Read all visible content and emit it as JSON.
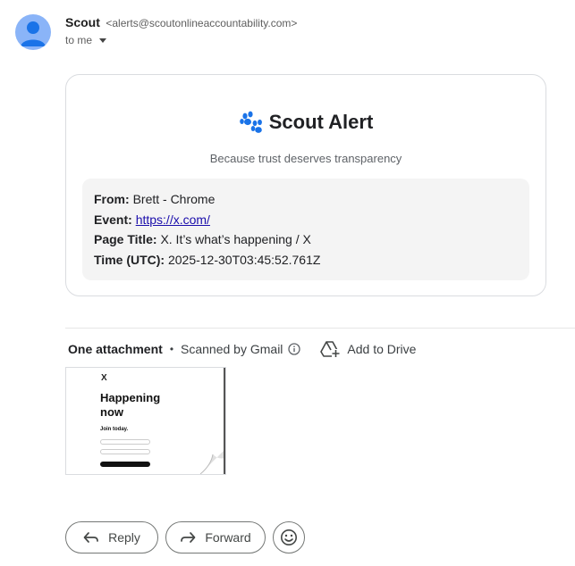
{
  "header": {
    "sender_name": "Scout",
    "sender_email": "<alerts@scoutonlineaccountability.com>",
    "to_label": "to me"
  },
  "card": {
    "title": "Scout Alert",
    "subtitle": "Because trust deserves transparency",
    "fields": [
      {
        "label": "From:",
        "value": "Brett - Chrome"
      },
      {
        "label": "Event:",
        "value": "https://x.com/"
      },
      {
        "label": "Page Title:",
        "value": "X. It’s what’s happening / X"
      },
      {
        "label": "Time (UTC):",
        "value": "2025-12-30T03:45:52.761Z"
      }
    ]
  },
  "attachments": {
    "title": "One attachment",
    "scan_status": "Scanned by Gmail",
    "drive_label": "Add to Drive"
  },
  "thumbnail": {
    "logo": "X",
    "headline": "Happening now",
    "join": "Join today."
  },
  "actions": {
    "reply_label": "Reply",
    "forward_label": "Forward"
  },
  "icons": {
    "avatar": "person-icon",
    "paw": "paw-icon",
    "info": "info-icon",
    "drive": "add-to-drive-icon",
    "reply": "reply-icon",
    "forward": "forward-icon",
    "emoji": "emoji-icon"
  },
  "colors": {
    "avatar_bg": "#8ab4f8",
    "avatar_fg": "#1a73e8",
    "link": "#1a0dab",
    "paw": "#1a73e8"
  }
}
